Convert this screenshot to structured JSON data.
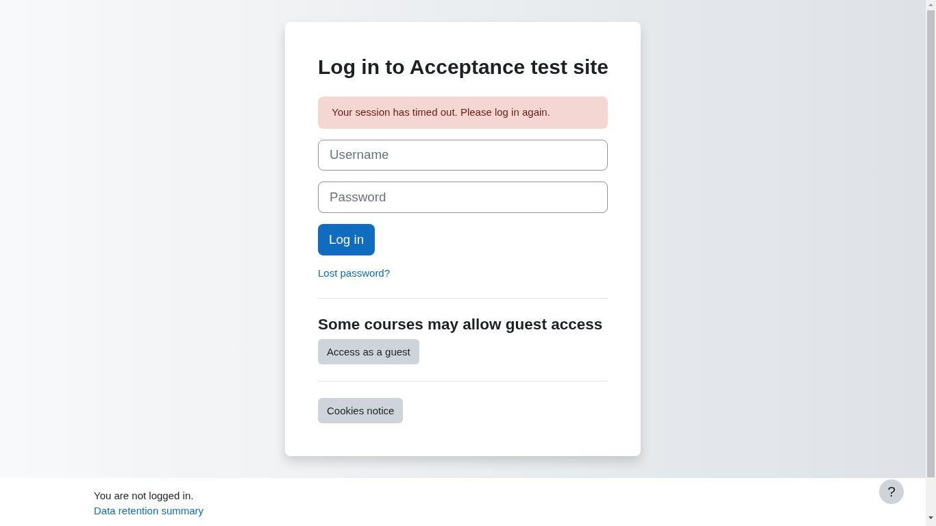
{
  "login": {
    "title": "Log in to Acceptance test site",
    "alert": "Your session has timed out. Please log in again.",
    "fields": [
      {
        "placeholder": "Username"
      },
      {
        "placeholder": "Password"
      }
    ],
    "submit": "Log in",
    "lost_password": "Lost password?"
  },
  "guest": {
    "heading": "Some courses may allow guest access",
    "button": "Access as a guest"
  },
  "cookies_button": "Cookies notice",
  "footer": {
    "status": "You are not logged in.",
    "link": "Data retention summary",
    "help": "?"
  }
}
